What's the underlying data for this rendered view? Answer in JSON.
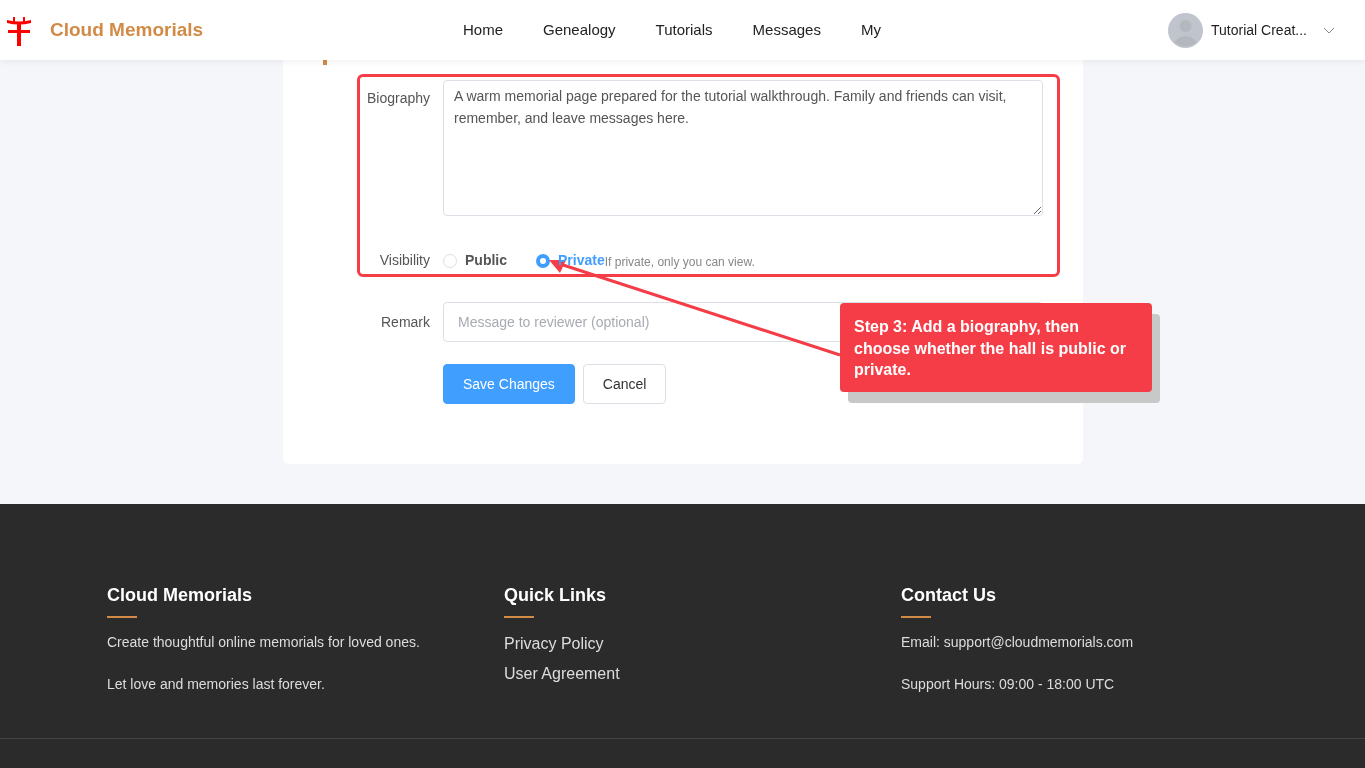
{
  "header": {
    "brand": "Cloud Memorials",
    "nav": [
      {
        "label": "Home"
      },
      {
        "label": "Genealogy"
      },
      {
        "label": "Tutorials"
      },
      {
        "label": "Messages"
      },
      {
        "label": "My"
      }
    ],
    "user": "Tutorial Creat..."
  },
  "form": {
    "biography": {
      "label": "Biography",
      "value": "A warm memorial page prepared for the tutorial walkthrough. Family and friends can visit, remember, and leave messages here."
    },
    "visibility": {
      "label": "Visibility",
      "options": [
        {
          "label": "Public",
          "selected": false
        },
        {
          "label": "Private",
          "selected": true
        }
      ],
      "hint": "If private, only you can view."
    },
    "remark": {
      "label": "Remark",
      "placeholder": "Message to reviewer (optional)"
    },
    "buttons": [
      {
        "label": "Save Changes",
        "kind": "primary"
      },
      {
        "label": "Cancel",
        "kind": "default"
      }
    ]
  },
  "callout": {
    "text": "Step 3: Add a biography, then choose whether the hall is public or private."
  },
  "footer": {
    "columns": [
      {
        "title": "Cloud Memorials",
        "items": [
          {
            "kind": "text",
            "text": "Create thoughtful online memorials for loved ones."
          },
          {
            "kind": "text",
            "text": "Let love and memories last forever."
          }
        ]
      },
      {
        "title": "Quick Links",
        "items": [
          {
            "kind": "link",
            "text": "Privacy Policy"
          },
          {
            "kind": "link",
            "text": "User Agreement"
          }
        ]
      },
      {
        "title": "Contact Us",
        "items": [
          {
            "kind": "text",
            "text": "Email: support@cloudmemorials.com"
          },
          {
            "kind": "text",
            "text": "Support Hours: 09:00 - 18:00 UTC"
          }
        ]
      }
    ]
  }
}
